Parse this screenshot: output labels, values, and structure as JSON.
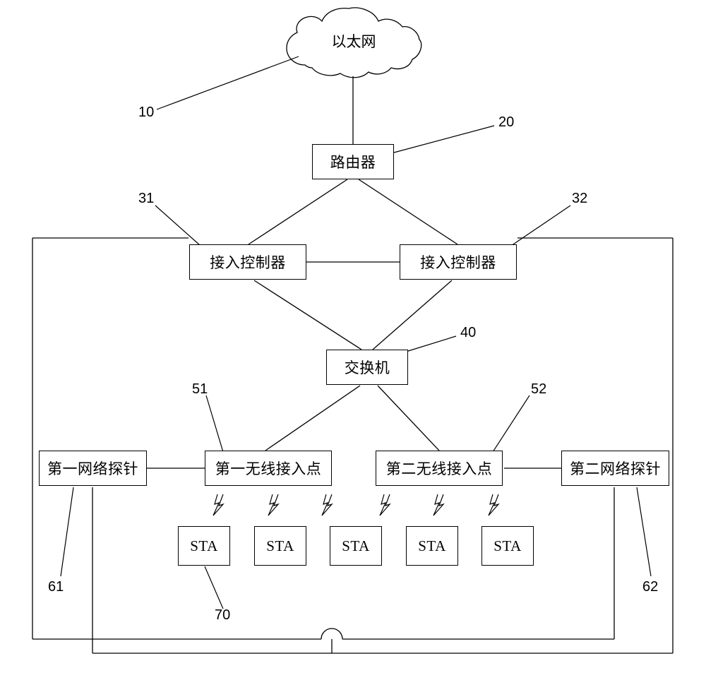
{
  "nodes": {
    "ethernet": "以太网",
    "router": "路由器",
    "ac1": "接入控制器",
    "ac2": "接入控制器",
    "switch": "交换机",
    "probe1": "第一网络探针",
    "ap1": "第一无线接入点",
    "ap2": "第二无线接入点",
    "probe2": "第二网络探针",
    "sta1": "STA",
    "sta2": "STA",
    "sta3": "STA",
    "sta4": "STA",
    "sta5": "STA"
  },
  "labels": {
    "l10": "10",
    "l20": "20",
    "l31": "31",
    "l32": "32",
    "l40": "40",
    "l51": "51",
    "l52": "52",
    "l61": "61",
    "l62": "62",
    "l70": "70"
  }
}
